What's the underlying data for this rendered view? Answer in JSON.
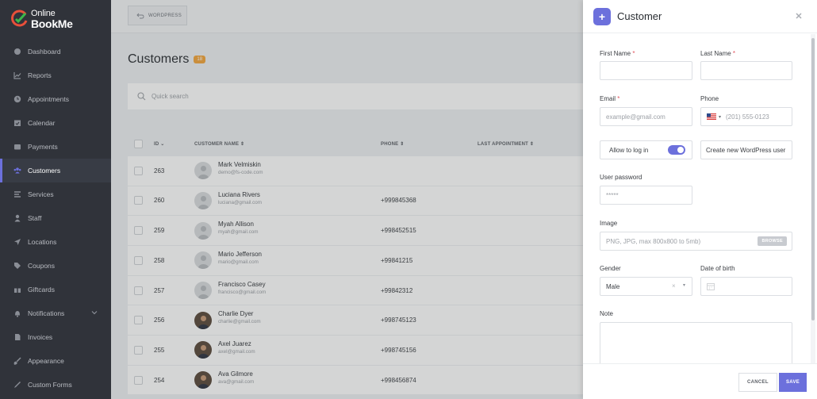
{
  "brand": {
    "line1": "Online",
    "line2": "BookMe"
  },
  "sidebar": {
    "items": [
      {
        "label": "Dashboard",
        "icon": "dashboard-icon"
      },
      {
        "label": "Reports",
        "icon": "chart-line-icon"
      },
      {
        "label": "Appointments",
        "icon": "clock-icon"
      },
      {
        "label": "Calendar",
        "icon": "calendar-icon"
      },
      {
        "label": "Payments",
        "icon": "wallet-icon"
      },
      {
        "label": "Customers",
        "icon": "users-icon",
        "active": true
      },
      {
        "label": "Services",
        "icon": "list-icon"
      },
      {
        "label": "Staff",
        "icon": "user-icon"
      },
      {
        "label": "Locations",
        "icon": "location-arrow-icon"
      },
      {
        "label": "Coupons",
        "icon": "tag-icon"
      },
      {
        "label": "Giftcards",
        "icon": "gift-icon"
      },
      {
        "label": "Notifications",
        "icon": "bell-icon"
      },
      {
        "label": "Invoices",
        "icon": "file-icon"
      },
      {
        "label": "Appearance",
        "icon": "brush-icon"
      },
      {
        "label": "Custom Forms",
        "icon": "pen-icon"
      }
    ]
  },
  "topbar": {
    "wp_label": "WORDPRESS"
  },
  "page": {
    "title": "Customers",
    "count": "18"
  },
  "search": {
    "placeholder": "Quick search"
  },
  "table": {
    "headers": {
      "id": "ID",
      "name": "CUSTOMER NAME",
      "phone": "PHONE",
      "last": "LAST APPOINTMENT"
    },
    "rows": [
      {
        "id": "263",
        "name": "Mark Velmiskin",
        "email": "demo@fs-code.com",
        "phone": "",
        "photo": false
      },
      {
        "id": "260",
        "name": "Luciana Rivers",
        "email": "luciana@gmail.com",
        "phone": "+999845368",
        "photo": false
      },
      {
        "id": "259",
        "name": "Myah Allison",
        "email": "myah@gmail.com",
        "phone": "+998452515",
        "photo": false
      },
      {
        "id": "258",
        "name": "Mario Jefferson",
        "email": "mario@gmail.com",
        "phone": "+99841215",
        "photo": false
      },
      {
        "id": "257",
        "name": "Francisco Casey",
        "email": "francisco@gmail.com",
        "phone": "+99842312",
        "photo": false
      },
      {
        "id": "256",
        "name": "Charlie Dyer",
        "email": "charlie@gmail.com",
        "phone": "+998745123",
        "photo": true
      },
      {
        "id": "255",
        "name": "Axel Juarez",
        "email": "axel@gmail.com",
        "phone": "+998745156",
        "photo": true
      },
      {
        "id": "254",
        "name": "Ava Gilmore",
        "email": "ava@gmail.com",
        "phone": "+998456874",
        "photo": true
      }
    ]
  },
  "panel": {
    "title": "Customer",
    "first_name": {
      "label": "First Name",
      "required": "*"
    },
    "last_name": {
      "label": "Last Name",
      "required": "*"
    },
    "email": {
      "label": "Email",
      "required": "*",
      "placeholder": "example@gmail.com"
    },
    "phone": {
      "label": "Phone",
      "placeholder": "(201) 555-0123"
    },
    "allow_login": {
      "label": "Allow to log in"
    },
    "create_wp_user": {
      "label": "Create new WordPress user"
    },
    "password": {
      "label": "User password",
      "value": "*****"
    },
    "image": {
      "label": "Image",
      "placeholder": "PNG, JPG, max 800x800 to 5mb)",
      "browse": "BROWSE"
    },
    "gender": {
      "label": "Gender",
      "value": "Male"
    },
    "dob": {
      "label": "Date of birth"
    },
    "note": {
      "label": "Note"
    },
    "cancel": "CANCEL",
    "save": "SAVE"
  },
  "colors": {
    "accent": "#6c70dc",
    "sidebar": "#30333a",
    "badge": "#f2a53b",
    "required": "#e2545e"
  }
}
